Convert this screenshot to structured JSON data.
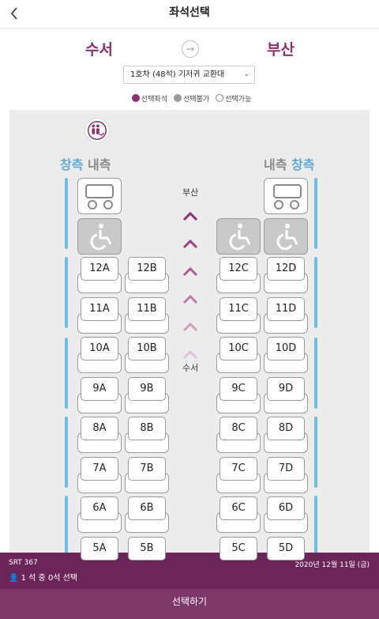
{
  "header": {
    "title": "좌석선택"
  },
  "route": {
    "from": "수서",
    "to": "부산",
    "arrow": "→"
  },
  "car_select": {
    "value": "1호차 (48석) 기저귀 교환대"
  },
  "legend": [
    {
      "label": "선택좌석",
      "color": "#8e2f72"
    },
    {
      "label": "선택불가",
      "color": "#9a9a9a"
    },
    {
      "label": "선택가능",
      "color": "#ffffff"
    }
  ],
  "map": {
    "left_label": {
      "window": "창측",
      "aisle": "내측"
    },
    "right_label": {
      "aisle": "내측",
      "window": "창측"
    },
    "direction_top": "부산",
    "direction_bottom": "수서",
    "rows": [
      {
        "left": [
          "12A",
          "12B"
        ],
        "right": [
          "12C",
          "12D"
        ]
      },
      {
        "left": [
          "11A",
          "11B"
        ],
        "right": [
          "11C",
          "11D"
        ]
      },
      {
        "left": [
          "10A",
          "10B"
        ],
        "right": [
          "10C",
          "10D"
        ]
      },
      {
        "left": [
          "9A",
          "9B"
        ],
        "right": [
          "9C",
          "9D"
        ]
      },
      {
        "left": [
          "8A",
          "8B"
        ],
        "right": [
          "8C",
          "8D"
        ]
      },
      {
        "left": [
          "7A",
          "7B"
        ],
        "right": [
          "7C",
          "7D"
        ]
      },
      {
        "left": [
          "6A",
          "6B"
        ],
        "right": [
          "6C",
          "6D"
        ]
      },
      {
        "left": [
          "5A",
          "5B"
        ],
        "right": [
          "5C",
          "5D"
        ]
      }
    ]
  },
  "footer": {
    "train": "SRT 367",
    "date": "2020년 12월 11일 (금)",
    "count": "1 석 중 0석 선택",
    "button": "선택하기"
  },
  "colors": {
    "brand": "#8e2f72",
    "footer": "#6c2559",
    "window_rail": "#6bbfe6"
  }
}
